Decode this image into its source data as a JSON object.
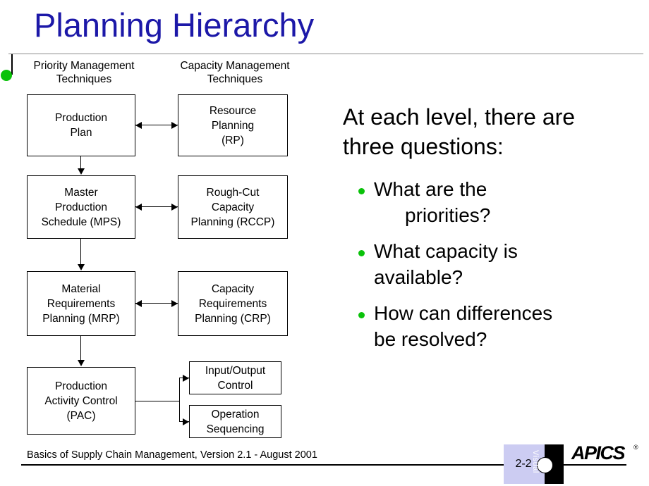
{
  "slide": {
    "title": "Planning Hierarchy",
    "title_color": "#1c18a8",
    "accent_green": "#0ac20a",
    "badge_lavender": "#ccccf2"
  },
  "diagram": {
    "column_headings": {
      "priority": "Priority Management\nTechniques",
      "capacity": "Capacity Management\nTechniques"
    },
    "priority_boxes": [
      {
        "id": "pp",
        "label": "Production\nPlan"
      },
      {
        "id": "mps",
        "label": "Master\nProduction\nSchedule (MPS)"
      },
      {
        "id": "mrp",
        "label": "Material\nRequirements\nPlanning (MRP)"
      },
      {
        "id": "pac",
        "label": "Production\nActivity Control\n(PAC)"
      }
    ],
    "capacity_boxes": [
      {
        "id": "rp",
        "label": "Resource\nPlanning\n(RP)"
      },
      {
        "id": "rccp",
        "label": "Rough-Cut\nCapacity\nPlanning (RCCP)"
      },
      {
        "id": "crp",
        "label": "Capacity\nRequirements\nPlanning (CRP)"
      },
      {
        "id": "ioc",
        "label": "Input/Output\nControl"
      },
      {
        "id": "os",
        "label": "Operation\nSequencing"
      }
    ]
  },
  "content": {
    "intro": "At each level, there are three questions:",
    "bullets": [
      {
        "line1": "What are the",
        "line2": "priorities?"
      },
      {
        "line1": "What capacity is",
        "line2": "available?"
      },
      {
        "line1": "How can differences",
        "line2": "be resolved?"
      }
    ]
  },
  "footer": {
    "source": "Basics of Supply Chain Management, Version 2.1 - August 2001",
    "page_number": "2-2",
    "badge_label": "Visual",
    "logo_text": "APICS",
    "logo_mark": "®"
  }
}
